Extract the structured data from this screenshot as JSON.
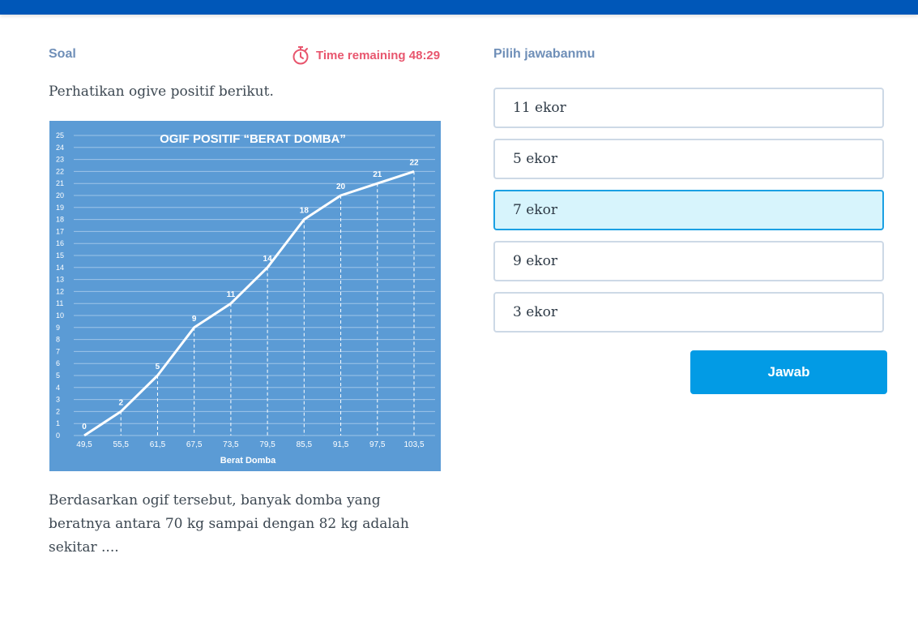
{
  "header": {
    "soal_label": "Soal",
    "timer_text": "Time remaining 48:29",
    "pilih_label": "Pilih jawabanmu"
  },
  "question": {
    "intro": "Perhatikan ogive positif berikut.",
    "text": "Berdasarkan ogif tersebut, banyak domba yang beratnya antara 70 kg sampai dengan 82 kg adalah sekitar ...."
  },
  "options": [
    {
      "label": "11 ekor",
      "selected": false
    },
    {
      "label": "5 ekor",
      "selected": false
    },
    {
      "label": "7 ekor",
      "selected": true
    },
    {
      "label": "9 ekor",
      "selected": false
    },
    {
      "label": "3 ekor",
      "selected": false
    }
  ],
  "submit_label": "Jawab",
  "colors": {
    "topbar": "#0057b8",
    "timer": "#e8566e",
    "chart_bg": "#5b9bd5",
    "selected_bg": "#d7f4fc",
    "selected_border": "#1aa0e3",
    "button": "#029be5"
  },
  "icons": {
    "timer": "stopwatch-icon"
  },
  "chart_data": {
    "type": "line",
    "title": "OGIF POSITIF “BERAT DOMBA”",
    "xlabel": "Berat Domba",
    "ylabel": "",
    "x": [
      "49,5",
      "55,5",
      "61,5",
      "67,5",
      "73,5",
      "79,5",
      "85,5",
      "91,5",
      "97,5",
      "103,5"
    ],
    "values": [
      0,
      2,
      5,
      9,
      11,
      14,
      18,
      20,
      21,
      22
    ],
    "ylim": [
      0,
      25
    ],
    "yticks": [
      0,
      1,
      2,
      3,
      4,
      5,
      6,
      7,
      8,
      9,
      10,
      11,
      12,
      13,
      14,
      15,
      16,
      17,
      18,
      19,
      20,
      21,
      22,
      23,
      24,
      25
    ],
    "grid": true
  }
}
